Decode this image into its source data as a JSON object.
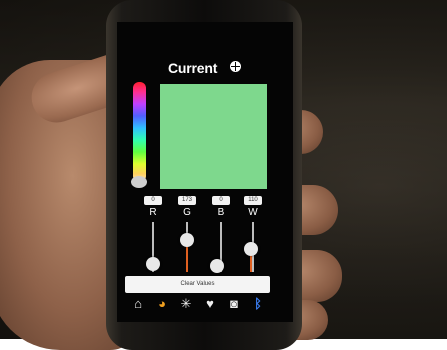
{
  "app": {
    "title": "Current"
  },
  "color_preview": {
    "hex": "#7ed88d"
  },
  "channels": [
    {
      "id": "r",
      "label": "R",
      "value": "0"
    },
    {
      "id": "g",
      "label": "G",
      "value": "173"
    },
    {
      "id": "b",
      "label": "B",
      "value": "0"
    },
    {
      "id": "w",
      "label": "W",
      "value": "110"
    }
  ],
  "clear_button": {
    "label": "Clear Values"
  },
  "tabs": [
    {
      "id": "home",
      "icon": "home-icon",
      "glyph": "⌂"
    },
    {
      "id": "palette",
      "icon": "palette-icon",
      "glyph": "◕"
    },
    {
      "id": "effects",
      "icon": "sparkle-icon",
      "glyph": "✳"
    },
    {
      "id": "favorites",
      "icon": "heart-icon",
      "glyph": "♥"
    },
    {
      "id": "camera",
      "icon": "camera-icon",
      "glyph": "◙"
    },
    {
      "id": "bluetooth",
      "icon": "bluetooth-icon",
      "glyph": "ᛒ"
    }
  ],
  "active_tab": "palette",
  "colors": {
    "accent": "#f0a020",
    "bluetooth": "#3a7cf0",
    "slider_fill": "#e06020"
  }
}
